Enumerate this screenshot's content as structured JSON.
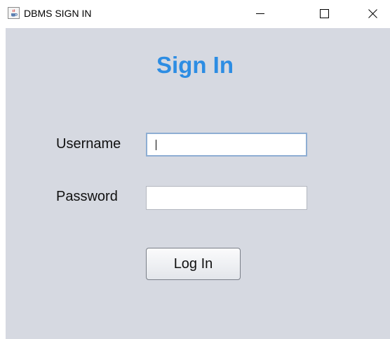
{
  "window": {
    "title": "DBMS SIGN IN",
    "icon": "java-cup-icon"
  },
  "controls": {
    "minimize_icon": "minimize-icon",
    "maximize_icon": "maximize-icon",
    "close_icon": "close-icon"
  },
  "form": {
    "heading": "Sign In",
    "username_label": "Username",
    "username_value": "",
    "password_label": "Password",
    "password_value": "",
    "login_label": "Log In"
  },
  "colors": {
    "heading": "#2d8de3",
    "background": "#d6d9e1",
    "focus_border": "#8eaed3"
  }
}
